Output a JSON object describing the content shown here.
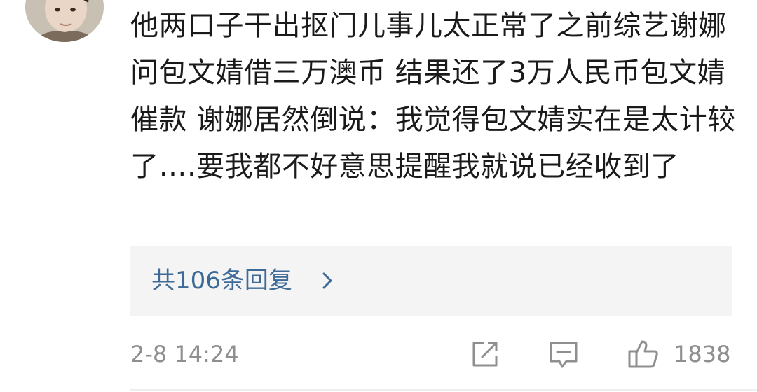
{
  "comment": {
    "text": "他两口子干出抠门儿事儿太正常了之前综艺谢娜问包文婧借三万澳币 结果还了3万人民币包文婧催款 谢娜居然倒说：我觉得包文婧实在是太计较了….要我都不好意思提醒我就说已经收到了",
    "replies_label": "共106条回复",
    "timestamp": "2-8 14:24",
    "like_count": "1838"
  },
  "icons": {
    "share": "share-icon",
    "comment": "comment-icon",
    "like": "thumbs-up-icon",
    "chevron": "chevron-right-icon"
  },
  "colors": {
    "link": "#3d6a96",
    "meta": "#8f8f8f",
    "text": "#1a1a1a",
    "reply_bg": "#f4f4f4"
  }
}
